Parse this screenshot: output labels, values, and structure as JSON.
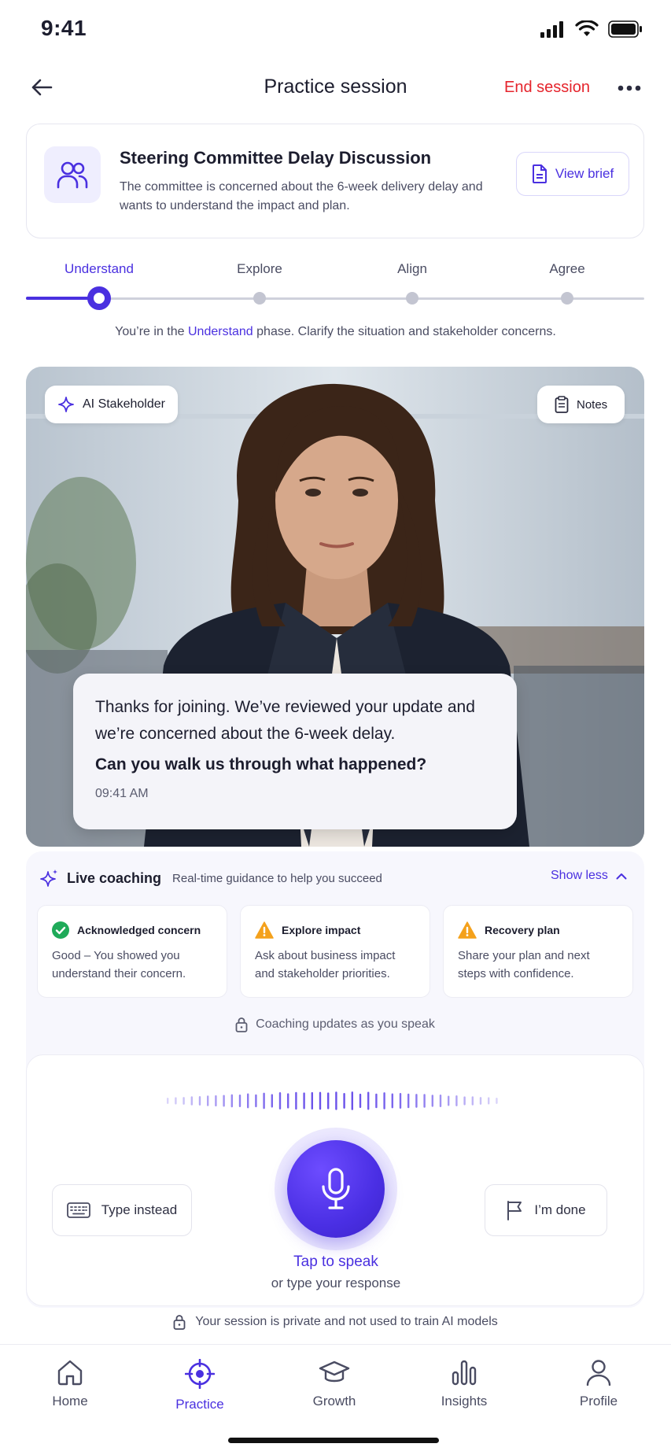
{
  "status_bar": {
    "time": "9:41"
  },
  "header": {
    "title": "Practice session",
    "end_session": "End session"
  },
  "scenario": {
    "title": "Steering Committee Delay Discussion",
    "description": "The committee is concerned about the 6-week delivery delay and wants to understand the impact and plan.",
    "view_brief": "View brief"
  },
  "steps": [
    {
      "label": "Understand",
      "active": true
    },
    {
      "label": "Explore",
      "active": false
    },
    {
      "label": "Align",
      "active": false
    },
    {
      "label": "Agree",
      "active": false
    }
  ],
  "phase": {
    "prefix": "You’re in the ",
    "highlight": "Understand",
    "suffix": " phase. Clarify the situation and stakeholder concerns."
  },
  "video": {
    "ai_label": "AI Stakeholder",
    "notes_label": "Notes",
    "message_line1": "Thanks for joining. We’ve reviewed your update and we’re concerned about the 6-week delay.",
    "message_line2": "Can you walk us through what happened?",
    "message_time": "09:41 AM"
  },
  "coaching": {
    "title": "Live coaching",
    "subtitle": "Real-time guidance to help you succeed",
    "toggle": "Show less",
    "tips": [
      {
        "status": "success",
        "title": "Acknowledged concern",
        "body": "Good – You showed you understand their concern."
      },
      {
        "status": "warning",
        "title": "Explore impact",
        "body": "Ask about business impact and stakeholder priorities."
      },
      {
        "status": "warning",
        "title": "Recovery plan",
        "body": "Share your plan and next steps with confidence."
      }
    ],
    "updates_note": "Coaching updates as you speak"
  },
  "speak": {
    "type_instead": "Type instead",
    "done": "I’m done",
    "tap_to_speak": "Tap to speak",
    "or_type": "or type your response"
  },
  "privacy_note": "Your session is private and not used to train AI models",
  "tabs": [
    {
      "label": "Home",
      "active": false
    },
    {
      "label": "Practice",
      "active": true
    },
    {
      "label": "Growth",
      "active": false
    },
    {
      "label": "Insights",
      "active": false
    },
    {
      "label": "Profile",
      "active": false
    }
  ],
  "colors": {
    "accent": "#4a30e0",
    "danger": "#e5242c",
    "success": "#1faa59",
    "warning": "#f4a11c"
  }
}
